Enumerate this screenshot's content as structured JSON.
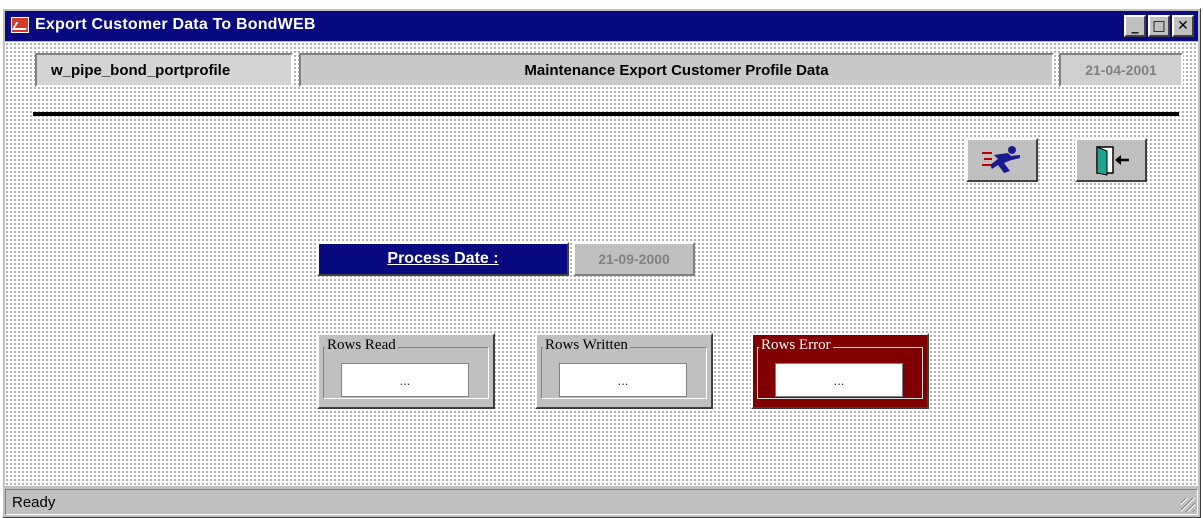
{
  "window": {
    "title": "Export Customer Data To BondWEB",
    "minimize_glyph": "_",
    "maximize_glyph": "□",
    "close_glyph": "✕"
  },
  "header": {
    "window_name": "w_pipe_bond_portprofile",
    "title": "Maintenance Export Customer Profile Data",
    "date": "21-04-2001"
  },
  "toolbar": {
    "run_icon": "running-man-icon",
    "exit_icon": "exit-door-icon"
  },
  "process": {
    "label": "Process Date :",
    "value": "21-09-2000"
  },
  "stats": {
    "rows_read": {
      "label": "Rows Read",
      "value": "..."
    },
    "rows_written": {
      "label": "Rows Written",
      "value": "..."
    },
    "rows_error": {
      "label": "Rows Error",
      "value": "..."
    }
  },
  "statusbar": {
    "text": "Ready"
  },
  "colors": {
    "title_bar": "#0a0a80",
    "process_label_bg": "#0a0a80",
    "error_group_bg": "#800000",
    "face": "#c0c0c0"
  }
}
